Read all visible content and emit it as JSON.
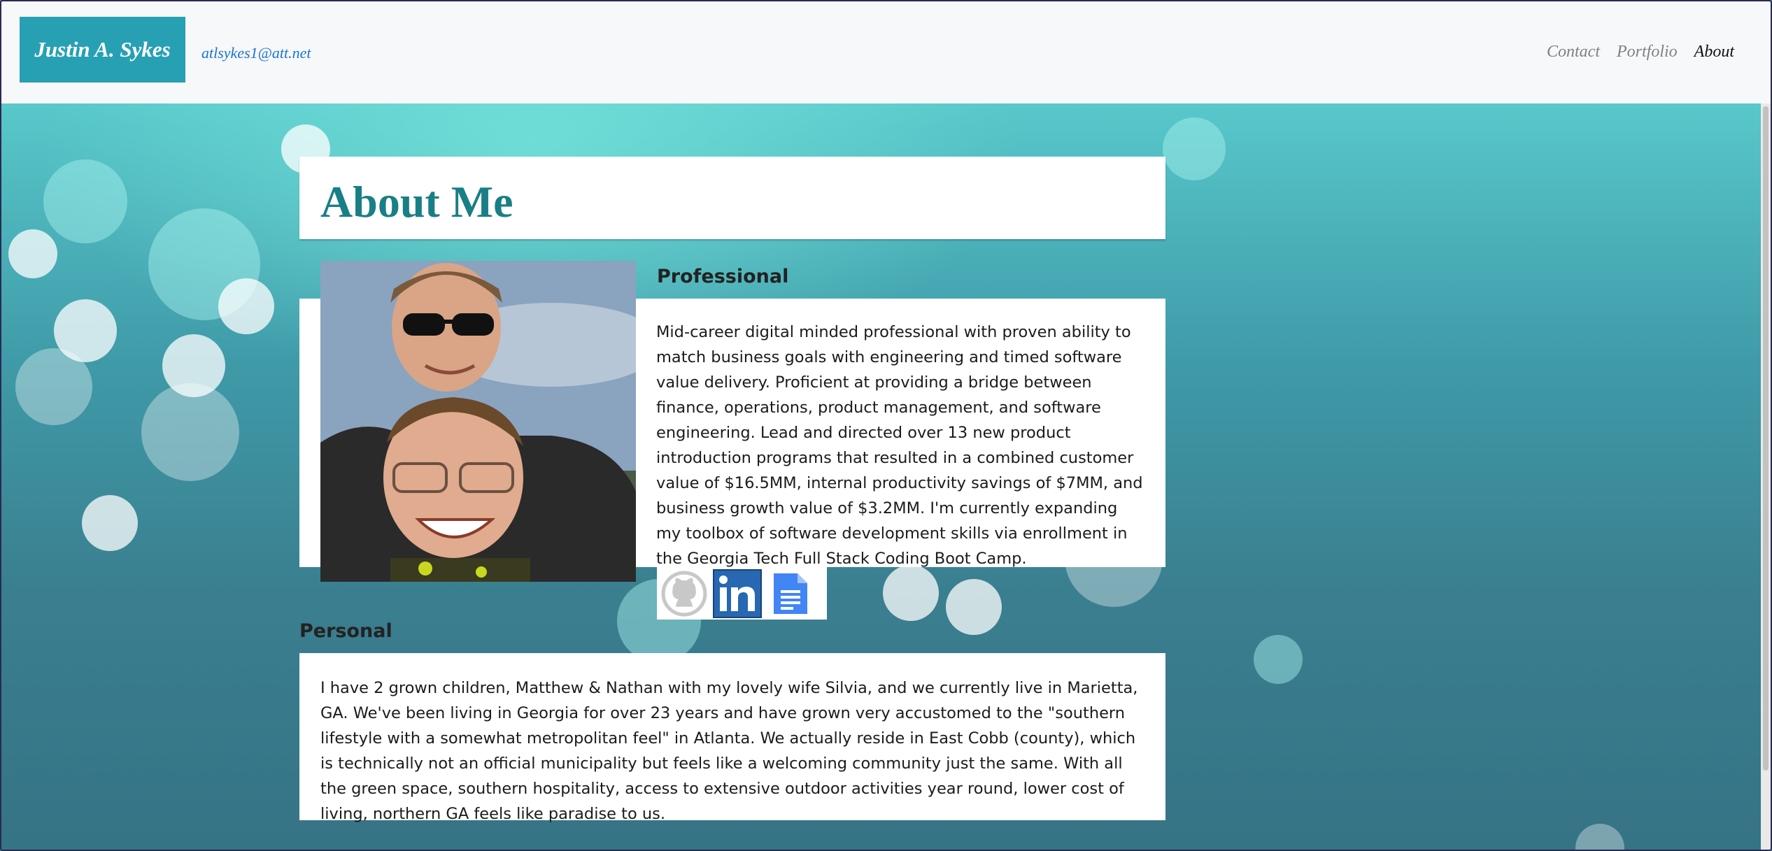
{
  "brand": {
    "name": "Justin A. Sykes"
  },
  "contact": {
    "email": "atlsykes1@att.net"
  },
  "nav": {
    "items": [
      {
        "label": "Contact",
        "active": false
      },
      {
        "label": "Portfolio",
        "active": false
      },
      {
        "label": "About",
        "active": true
      }
    ]
  },
  "page": {
    "title": "About Me"
  },
  "professional": {
    "heading": "Professional",
    "body": "Mid-career digital minded professional with proven ability to match business goals with engineering and timed software value delivery. Proficient at providing a bridge between finance, operations, product management, and software engineering. Lead and directed over 13 new product introduction programs that resulted in a combined customer value of $16.5MM, internal productivity savings of $7MM, and business growth value of $3.2MM. I'm currently expanding my toolbox of software development skills via enrollment in the Georgia Tech Full Stack Coding Boot Camp."
  },
  "social": {
    "icons": [
      "github-icon",
      "linkedin-icon",
      "google-docs-icon"
    ]
  },
  "personal": {
    "heading": "Personal",
    "body": "I have 2 grown children, Matthew & Nathan with my lovely wife Silvia, and we currently live in Marietta, GA. We've been living in Georgia for over 23 years and have grown very accustomed to the \"southern lifestyle with a somewhat metropolitan feel\" in Atlanta. We actually reside in East Cobb (county), which is technically not an official municipality but feels like a welcoming community just the same. With all the green space, southern hospitality, access to extensive outdoor activities year round, lower cost of living, northern GA feels like paradise to us."
  },
  "colors": {
    "brand_bg": "#27a0b4",
    "title": "#197f86",
    "link": "#1a73d9",
    "linkedin": "#2867b2",
    "gdocs": "#4285f4"
  }
}
